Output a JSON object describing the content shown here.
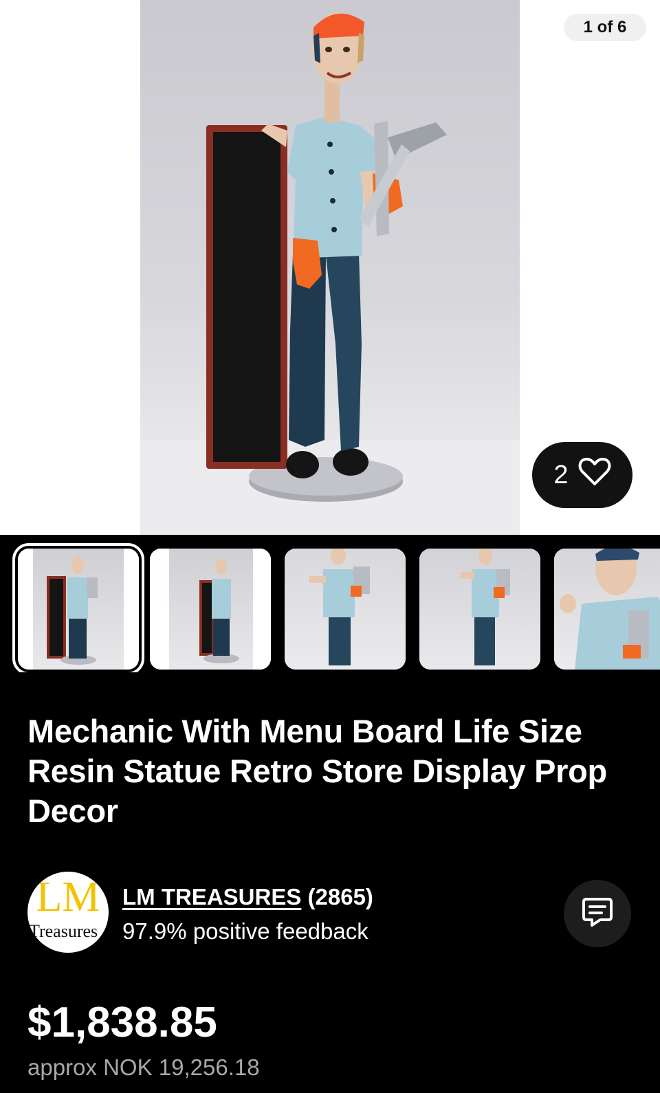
{
  "gallery": {
    "counter": "1 of 6",
    "watch_count": "2",
    "watch_icon": "heart-outline-icon",
    "main_image": "mechanic-statue-with-menu-board",
    "thumbnails": [
      {
        "image": "mechanic-statue-front-with-board",
        "selected": true
      },
      {
        "image": "mechanic-statue-front-with-board-alt",
        "selected": false
      },
      {
        "image": "mechanic-statue-side-wrenches",
        "selected": false
      },
      {
        "image": "mechanic-statue-angle-wrenches",
        "selected": false
      },
      {
        "image": "mechanic-statue-closeup",
        "selected": false
      }
    ]
  },
  "listing": {
    "title": "Mechanic With Menu Board Life Size Resin Statue Retro Store Display Prop Decor"
  },
  "seller": {
    "avatar_text_top": "LM",
    "avatar_text_bottom": "Treasures",
    "name": "LM TREASURES",
    "rating_count": "(2865)",
    "feedback": "97.9% positive feedback",
    "message_icon": "chat-message-icon"
  },
  "price": {
    "amount": "$1,838.85",
    "approx": "approx NOK 19,256.18"
  },
  "colors": {
    "background": "#000000",
    "chip_background": "#121212",
    "secondary_text": "#a9a9a9",
    "logo_yellow": "#f3c200"
  }
}
